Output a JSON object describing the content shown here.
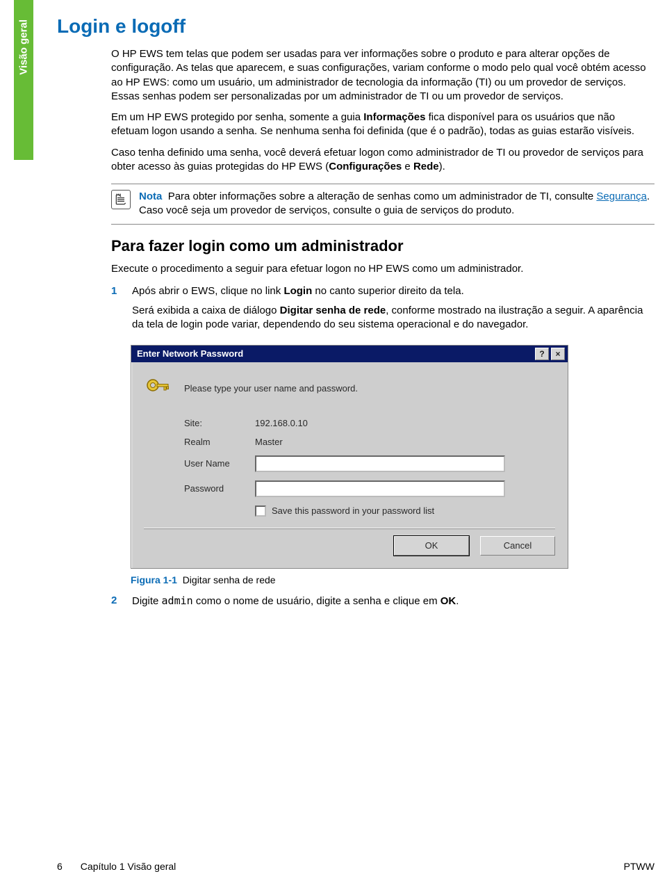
{
  "sideTab": "Visão geral",
  "h1": "Login e logoff",
  "para1": "O HP EWS tem telas que podem ser usadas para ver informações sobre o produto e para alterar opções de configuração. As telas que aparecem, e suas configurações, variam conforme o modo pelo qual você obtém acesso ao HP EWS: como um usuário, um administrador de tecnologia da informação (TI) ou um provedor de serviços. Essas senhas podem ser personalizadas por um administrador de TI ou um provedor de serviços.",
  "para2a": "Em um HP EWS protegido por senha, somente a guia ",
  "para2bold1": "Informações",
  "para2b": " fica disponível para os usuários que não efetuam logon usando a senha. Se nenhuma senha foi definida (que é o padrão), todas as guias estarão visíveis.",
  "para3a": "Caso tenha definido uma senha, você deverá efetuar logon como administrador de TI ou provedor de serviços para obter acesso às guias protegidas do HP EWS (",
  "para3bold1": "Configurações",
  "para3mid": " e ",
  "para3bold2": "Rede",
  "para3end": ").",
  "note": {
    "lead": "Nota",
    "t1": "Para obter informações sobre a alteração de senhas como um administrador de TI, consulte ",
    "link": "Segurança",
    "t2": ". Caso você seja um provedor de serviços, consulte o guia de serviços do produto."
  },
  "h2": "Para fazer login como um administrador",
  "intro2": "Execute o procedimento a seguir para efetuar logon no HP EWS como um administrador.",
  "steps": [
    {
      "num": "1",
      "l1a": "Após abrir o EWS, clique no link ",
      "l1bold": "Login",
      "l1b": " no canto superior direito da tela.",
      "l2a": "Será exibida a caixa de diálogo ",
      "l2bold": "Digitar senha de rede",
      "l2b": ", conforme mostrado na ilustração a seguir. A aparência da tela de login pode variar, dependendo do seu sistema operacional e do navegador."
    },
    {
      "num": "2",
      "l1a": "Digite ",
      "l1code": "admin",
      "l1b": " como o nome de usuário, digite a senha e clique em ",
      "l1bold": "OK",
      "l1c": "."
    }
  ],
  "dialog": {
    "title": "Enter Network Password",
    "help": "?",
    "close": "×",
    "prompt": "Please type your user name and password.",
    "siteLabel": "Site:",
    "siteValue": "192.168.0.10",
    "realmLabel": "Realm",
    "realmValue": "Master",
    "userLabel": "User Name",
    "userValue": "",
    "passLabel": "Password",
    "passValue": "",
    "saveChk": "Save this password in your password list",
    "ok": "OK",
    "cancel": "Cancel"
  },
  "figure": {
    "lead": "Figura 1-1",
    "text": "Digitar senha de rede"
  },
  "footer": {
    "page": "6",
    "chapter": "Capítulo 1   Visão geral",
    "lang": "PTWW"
  }
}
